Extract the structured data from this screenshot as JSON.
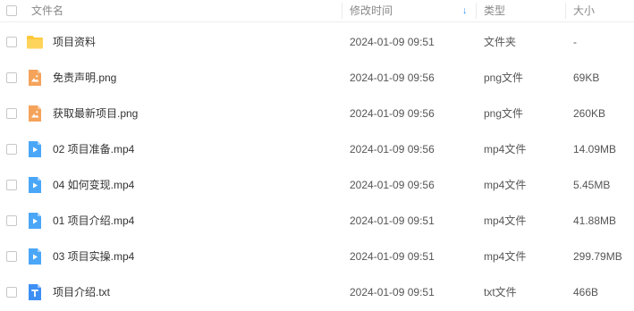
{
  "header": {
    "name_label": "文件名",
    "time_label": "修改时间",
    "type_label": "类型",
    "size_label": "大小",
    "sort_icon": "arrow-down-icon"
  },
  "colors": {
    "folder": "#ffc93c",
    "image": "#f5a35b",
    "video": "#4aa7f8",
    "text": "#3d8ff5",
    "sort_accent": "#2f8df8"
  },
  "rows": [
    {
      "name": "项目资料",
      "time": "2024-01-09 09:51",
      "type": "文件夹",
      "size": "-",
      "icon": "folder-icon"
    },
    {
      "name": "免责声明.png",
      "time": "2024-01-09 09:56",
      "type": "png文件",
      "size": "69KB",
      "icon": "image-file-icon"
    },
    {
      "name": "获取最新项目.png",
      "time": "2024-01-09 09:56",
      "type": "png文件",
      "size": "260KB",
      "icon": "image-file-icon"
    },
    {
      "name": "02 项目准备.mp4",
      "time": "2024-01-09 09:56",
      "type": "mp4文件",
      "size": "14.09MB",
      "icon": "video-file-icon"
    },
    {
      "name": "04 如何变现.mp4",
      "time": "2024-01-09 09:56",
      "type": "mp4文件",
      "size": "5.45MB",
      "icon": "video-file-icon"
    },
    {
      "name": "01 项目介绍.mp4",
      "time": "2024-01-09 09:51",
      "type": "mp4文件",
      "size": "41.88MB",
      "icon": "video-file-icon"
    },
    {
      "name": "03 项目实操.mp4",
      "time": "2024-01-09 09:51",
      "type": "mp4文件",
      "size": "299.79MB",
      "icon": "video-file-icon"
    },
    {
      "name": "项目介绍.txt",
      "time": "2024-01-09 09:51",
      "type": "txt文件",
      "size": "466B",
      "icon": "text-file-icon"
    }
  ]
}
